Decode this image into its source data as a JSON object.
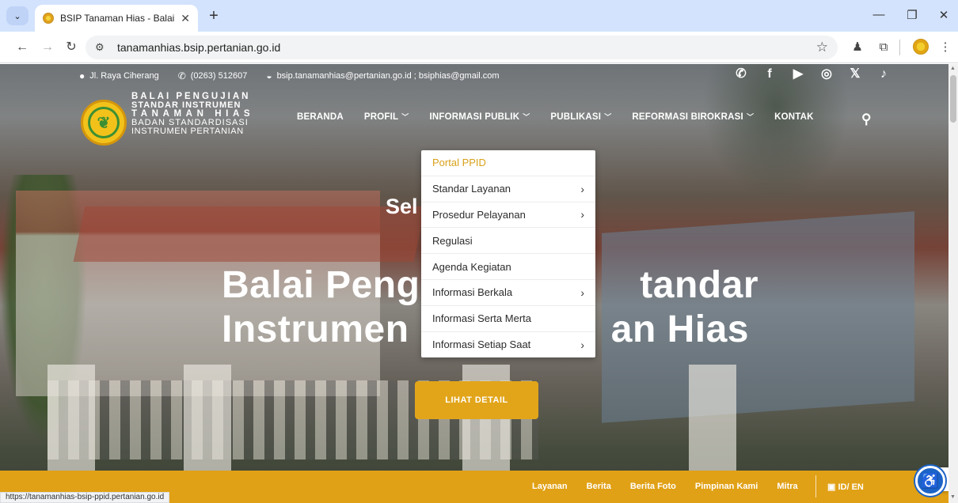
{
  "browser": {
    "tab_title": "BSIP Tanaman Hias - Balai Peng",
    "tab_close": "✕",
    "new_tab": "+",
    "url": "tanamanhias.bsip.pertanian.go.id",
    "status_url": "https://tanamanhias-bsip-ppid.pertanian.go.id",
    "icons": [
      "tab-search-icon",
      "back-icon",
      "forward-icon",
      "reload-icon",
      "site-info-icon",
      "bookmark-star-icon",
      "extension-icon",
      "puzzle-icon",
      "profile-avatar",
      "menu-icon",
      "minimize-icon",
      "restore-icon",
      "close-icon"
    ]
  },
  "topbar": {
    "address": "Jl. Raya Ciherang",
    "phone": "(0263) 512607",
    "email": "bsip.tanamanhias@pertanian.go.id ; bsiphias@gmail.com",
    "social_icons": [
      "whatsapp-icon",
      "facebook-icon",
      "youtube-icon",
      "instagram-icon",
      "x-icon",
      "tiktok-icon"
    ]
  },
  "logo": {
    "line1": "BALAI PENGUJIAN",
    "line2": "STANDAR INSTRUMEN",
    "line3": "TANAMAN HIAS",
    "line4": "BADAN STANDARDISASI",
    "line5": "INSTRUMEN PERTANIAN"
  },
  "nav": {
    "items": [
      {
        "label": "BERANDA",
        "has_dropdown": false
      },
      {
        "label": "PROFIL",
        "has_dropdown": true
      },
      {
        "label": "INFORMASI PUBLIK",
        "has_dropdown": true
      },
      {
        "label": "PUBLIKASI",
        "has_dropdown": true
      },
      {
        "label": "REFORMASI BIROKRASI",
        "has_dropdown": true
      },
      {
        "label": "KONTAK",
        "has_dropdown": false
      }
    ]
  },
  "dropdown": {
    "items": [
      {
        "label": "Portal PPID",
        "submenu": false,
        "active": true
      },
      {
        "label": "Standar Layanan",
        "submenu": true
      },
      {
        "label": "Prosedur Pelayanan",
        "submenu": true
      },
      {
        "label": "Regulasi",
        "submenu": false
      },
      {
        "label": "Agenda Kegiatan",
        "submenu": false
      },
      {
        "label": "Informasi Berkala",
        "submenu": true
      },
      {
        "label": "Informasi Serta Merta",
        "submenu": false
      },
      {
        "label": "Informasi Setiap Saat",
        "submenu": true
      }
    ]
  },
  "hero": {
    "subtitle": "Sel",
    "title_line1": "Balai Peng",
    "title_line1_tail": "tandar",
    "title_line2": "Instrumen",
    "title_line2_tail": "an Hias",
    "cta": "LIHAT DETAIL"
  },
  "footerbar": {
    "links": [
      "Layanan",
      "Berita",
      "Berita Foto",
      "Pimpinan Kami",
      "Mitra"
    ],
    "lang": "ID/ EN"
  },
  "colors": {
    "accent": "#e2a51a",
    "dropdown_active": "#d9a11a",
    "chrome_tabbar": "#d3e3fd",
    "a11y": "#1c63c7"
  }
}
